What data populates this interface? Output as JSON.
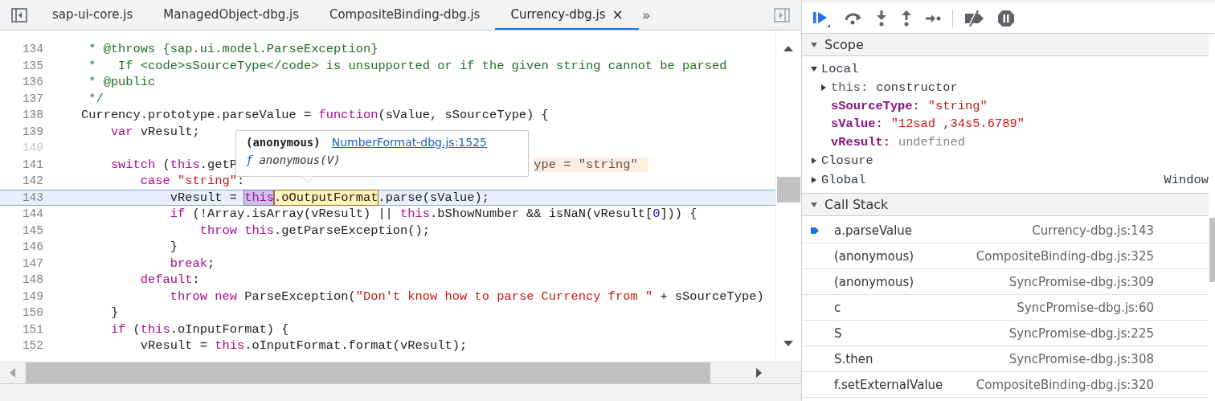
{
  "editor": {
    "tabs": [
      {
        "label": "sap-ui-core.js",
        "selected": false
      },
      {
        "label": "ManagedObject-dbg.js",
        "selected": false
      },
      {
        "label": "CompositeBinding-dbg.js",
        "selected": false
      },
      {
        "label": "Currency-dbg.js",
        "selected": true
      }
    ],
    "close": "×",
    "more": "»",
    "lines": [
      {
        "number": "134",
        "current": false,
        "dimmed": false,
        "tokens": [
          {
            "kind": "comment",
            "text": "     * @throws {sap.ui.model.ParseException}"
          }
        ]
      },
      {
        "number": "135",
        "current": false,
        "dimmed": false,
        "tokens": [
          {
            "kind": "comment",
            "text": "     *   If <code>sSourceType</code> is unsupported or if the given string cannot be parsed"
          }
        ]
      },
      {
        "number": "136",
        "current": false,
        "dimmed": false,
        "tokens": [
          {
            "kind": "comment",
            "text": "     * @public"
          }
        ]
      },
      {
        "number": "137",
        "current": false,
        "dimmed": false,
        "tokens": [
          {
            "kind": "comment",
            "text": "     */"
          }
        ]
      },
      {
        "number": "138",
        "current": false,
        "dimmed": false,
        "tokens": [
          {
            "kind": "plain",
            "text": "    Currency.prototype.parseValue = "
          },
          {
            "kind": "keyword",
            "text": "function"
          },
          {
            "kind": "plain",
            "text": "(sValue, sSourceType) {"
          }
        ]
      },
      {
        "number": "139",
        "current": false,
        "dimmed": false,
        "tokens": [
          {
            "kind": "keyword",
            "text": "        var"
          },
          {
            "kind": "plain",
            "text": " vResult;"
          }
        ]
      },
      {
        "number": "140",
        "current": false,
        "dimmed": true
      },
      {
        "number": "141",
        "current": false,
        "dimmed": false,
        "tokens": [
          {
            "kind": "keyword",
            "text": "        switch"
          },
          {
            "kind": "plain",
            "text": " ("
          },
          {
            "kind": "keyword",
            "text": "this"
          },
          {
            "kind": "plain",
            "text": ".getP"
          }
        ],
        "inline_value": "ype = \"string\""
      },
      {
        "number": "142",
        "current": false,
        "dimmed": false,
        "tokens": [
          {
            "kind": "keyword",
            "text": "            case"
          },
          {
            "kind": "string",
            "text": " \"string\""
          },
          {
            "kind": "plain",
            "text": ":"
          }
        ]
      },
      {
        "number": "143",
        "current": true,
        "dimmed": false,
        "tokens": [
          {
            "kind": "plain",
            "text": "                vResult = "
          },
          {
            "kind": "this-highlight",
            "text": "this"
          },
          {
            "kind": "expression-highlight",
            "text": ".oOutputFormat"
          },
          {
            "kind": "plain",
            "text": ".parse(sValue);"
          }
        ]
      },
      {
        "number": "144",
        "current": false,
        "dimmed": false,
        "tokens": [
          {
            "kind": "keyword",
            "text": "                if"
          },
          {
            "kind": "plain",
            "text": " (!Array.isArray(vResult) || "
          },
          {
            "kind": "keyword",
            "text": "this"
          },
          {
            "kind": "plain",
            "text": ".bShowNumber && isNaN(vResult["
          },
          {
            "kind": "number",
            "text": "0"
          },
          {
            "kind": "plain",
            "text": "])) {"
          }
        ]
      },
      {
        "number": "145",
        "current": false,
        "dimmed": false,
        "tokens": [
          {
            "kind": "keyword",
            "text": "                    throw"
          },
          {
            "kind": "keyword",
            "text": " this"
          },
          {
            "kind": "plain",
            "text": ".getParseException();"
          }
        ]
      },
      {
        "number": "146",
        "current": false,
        "dimmed": false,
        "tokens": [
          {
            "kind": "plain",
            "text": "                }"
          }
        ]
      },
      {
        "number": "147",
        "current": false,
        "dimmed": false,
        "tokens": [
          {
            "kind": "keyword",
            "text": "                break"
          },
          {
            "kind": "plain",
            "text": ";"
          }
        ]
      },
      {
        "number": "148",
        "current": false,
        "dimmed": false,
        "tokens": [
          {
            "kind": "keyword",
            "text": "            default"
          },
          {
            "kind": "plain",
            "text": ":"
          }
        ]
      },
      {
        "number": "149",
        "current": false,
        "dimmed": false,
        "tokens": [
          {
            "kind": "keyword",
            "text": "                throw"
          },
          {
            "kind": "keyword",
            "text": " new"
          },
          {
            "kind": "plain",
            "text": " ParseException("
          },
          {
            "kind": "string",
            "text": "\"Don't know how to parse Currency from \""
          },
          {
            "kind": "plain",
            "text": " + sSourceType)"
          }
        ]
      },
      {
        "number": "150",
        "current": false,
        "dimmed": false,
        "tokens": [
          {
            "kind": "plain",
            "text": "        }"
          }
        ]
      },
      {
        "number": "151",
        "current": false,
        "dimmed": false,
        "tokens": [
          {
            "kind": "keyword",
            "text": "        if"
          },
          {
            "kind": "plain",
            "text": " ("
          },
          {
            "kind": "keyword",
            "text": "this"
          },
          {
            "kind": "plain",
            "text": ".oInputFormat) {"
          }
        ]
      },
      {
        "number": "152",
        "current": false,
        "dimmed": false,
        "tokens": [
          {
            "kind": "plain",
            "text": "            vResult = "
          },
          {
            "kind": "keyword",
            "text": "this"
          },
          {
            "kind": "plain",
            "text": ".oInputFormat.format(vResult);"
          }
        ]
      }
    ],
    "tooltip": {
      "title": "(anonymous)",
      "link": "NumberFormat-dbg.js:1525",
      "function_mark": "ƒ",
      "signature": "anonymous(V)"
    }
  },
  "debugger": {
    "scope": {
      "title": "Scope",
      "expanded": true,
      "groups": [
        {
          "name": "Local",
          "expanded": true,
          "children": [
            {
              "name": "this:",
              "value": "constructor",
              "kind": "object",
              "expanded": false
            },
            {
              "name": "sSourceType:",
              "value": "\"string\"",
              "kind": "string"
            },
            {
              "name": "sValue:",
              "value": "\"12sad ,34s5.6789\"",
              "kind": "string"
            },
            {
              "name": "vResult:",
              "value": "undefined",
              "kind": "undefined"
            }
          ]
        },
        {
          "name": "Closure",
          "expanded": false
        },
        {
          "name": "Global",
          "expanded": false,
          "value": "Window"
        }
      ]
    },
    "call_stack": {
      "title": "Call Stack",
      "expanded": true,
      "frames": [
        {
          "name": "a.parseValue",
          "location": "Currency-dbg.js:143",
          "selected": true
        },
        {
          "name": "(anonymous)",
          "location": "CompositeBinding-dbg.js:325",
          "selected": false
        },
        {
          "name": "(anonymous)",
          "location": "SyncPromise-dbg.js:309",
          "selected": false
        },
        {
          "name": "c",
          "location": "SyncPromise-dbg.js:60",
          "selected": false
        },
        {
          "name": "S",
          "location": "SyncPromise-dbg.js:225",
          "selected": false
        },
        {
          "name": "S.then",
          "location": "SyncPromise-dbg.js:308",
          "selected": false
        },
        {
          "name": "f.setExternalValue",
          "location": "CompositeBinding-dbg.js:320",
          "selected": false
        }
      ]
    }
  }
}
